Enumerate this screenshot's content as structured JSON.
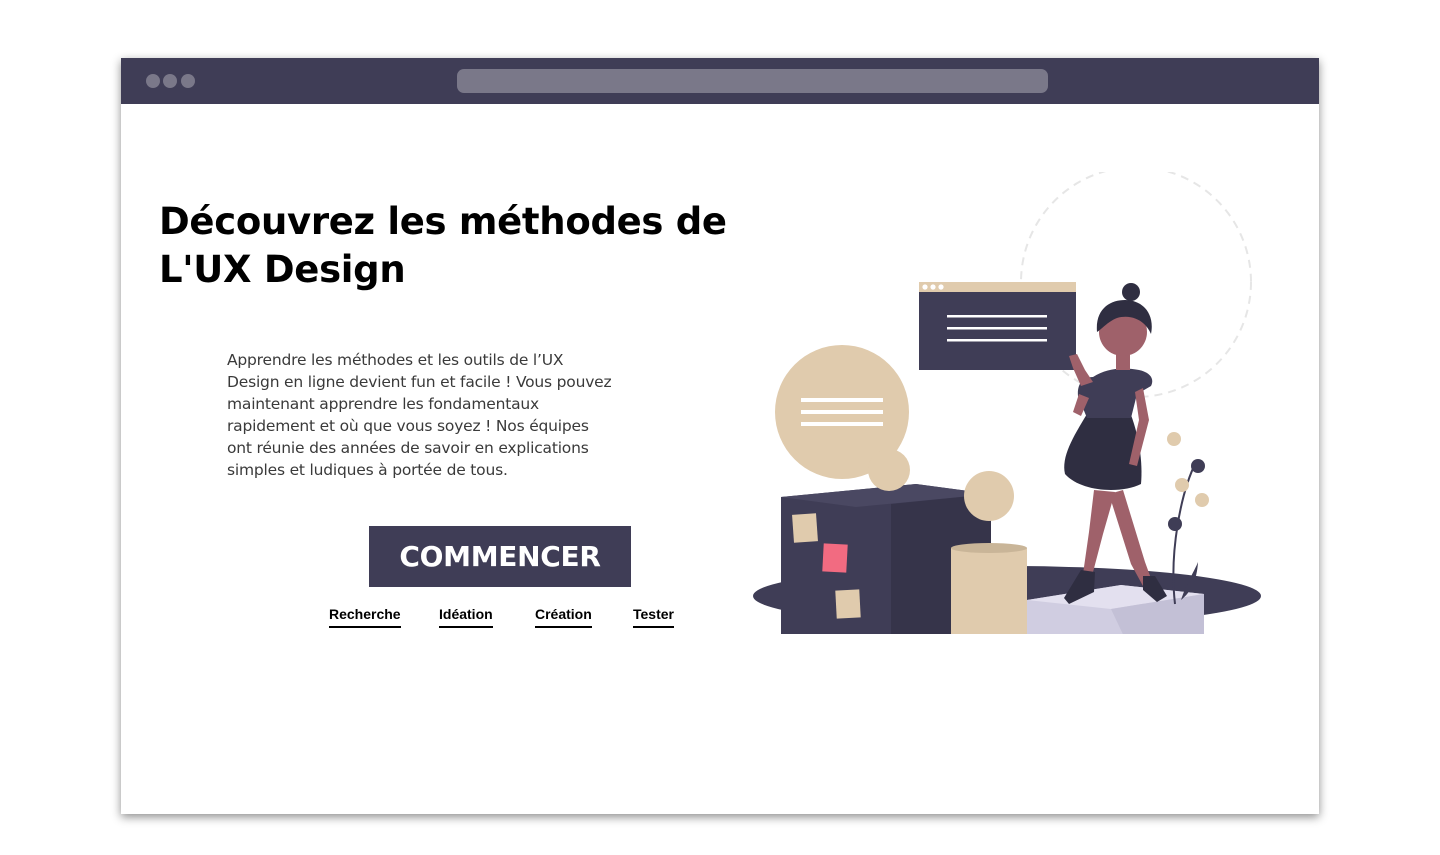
{
  "hero": {
    "title_line1": "Découvrez les méthodes de",
    "title_line2": "L'UX Design",
    "description": "Apprendre les méthodes et les outils de l’UX Design en ligne devient fun et facile ! Vous pouvez maintenant apprendre les fondamentaux rapidement et où que vous soyez ! Nos équipes ont réunie des années de savoir en explications simples et ludiques à portée de tous.",
    "cta_label": "COMMENCER"
  },
  "nav": {
    "links": [
      "Recherche",
      "Idéation",
      "Création",
      "Tester"
    ]
  },
  "colors": {
    "brand_dark": "#3f3d56",
    "beige": "#e0cbad",
    "accent_pink": "#f26b81",
    "light_block": "#d0cde1"
  },
  "icons": {
    "window_controls": "three-dots-icon",
    "illustration": "woman-presenting-ux-illustration"
  }
}
